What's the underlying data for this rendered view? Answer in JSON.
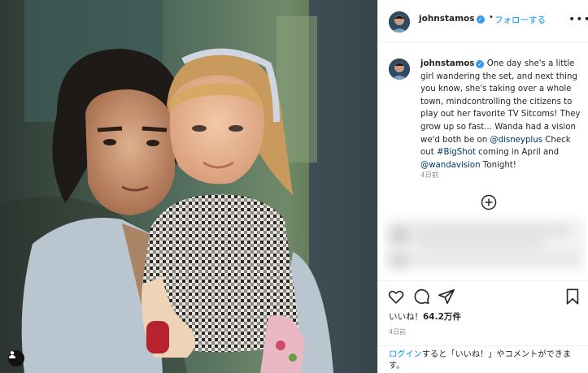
{
  "post": {
    "username": "johnstamos",
    "verified_mark": "✓",
    "separator": "•",
    "follow_label": "フォローする",
    "more_icon": "more-horizontal-icon",
    "caption": {
      "username": "johnstamos",
      "text_1": "One day she's a little girl wandering the set, and next thing you know, she's taking over a whole town, mindcontrolling the citizens to play out her favorite TV Sitcoms! They grow up so fast... Wanda had a vision we'd both be on ",
      "mention_1": "@disneyplus",
      "text_2": " Check out ",
      "hashtag": "#BigShot",
      "text_3": " coming in April and ",
      "mention_2": "@wandavision",
      "text_4": " Tonight!",
      "time": "4日前"
    },
    "likes_prefix": "いいね！",
    "likes_count": "64.2万件",
    "time": "4日前",
    "login_link": "ログイン",
    "login_text": "すると「いいね！」やコメントができます。"
  },
  "icons": {
    "photo_tag": "user-tag-icon",
    "load_more": "plus-circle-icon",
    "like": "heart-icon",
    "comment": "comment-icon",
    "share": "paper-plane-icon",
    "save": "bookmark-icon"
  },
  "colors": {
    "link_blue": "#0095f6",
    "text": "#262626",
    "muted": "#8e8e8e",
    "border": "#efefef",
    "verified": "#3897f0"
  }
}
